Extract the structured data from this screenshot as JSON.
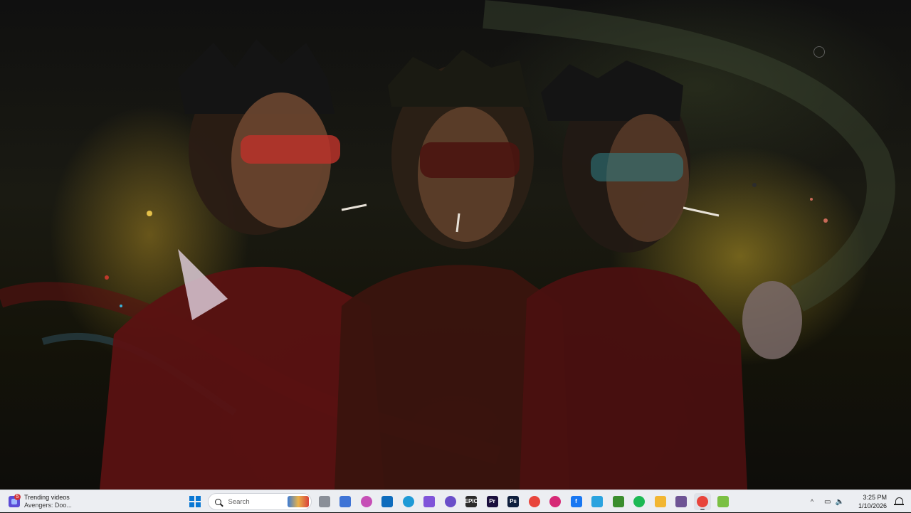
{
  "widget": {
    "badge": "5",
    "title": "Trending videos",
    "subtitle": "Avengers: Doo..."
  },
  "search": {
    "placeholder": "Search"
  },
  "taskbar_apps": [
    {
      "name": "file-explorer-doc",
      "label": "",
      "color": "#8a8f98"
    },
    {
      "name": "microsoft-store",
      "label": "",
      "color": "#3f74d6"
    },
    {
      "name": "copilot",
      "label": "",
      "color": "#c64fb6"
    },
    {
      "name": "outlook",
      "label": "",
      "color": "#0f6cbd"
    },
    {
      "name": "edge",
      "label": "",
      "color": "#1f9ad6"
    },
    {
      "name": "m365",
      "label": "",
      "color": "#8054d9"
    },
    {
      "name": "edge-dev",
      "label": "",
      "color": "#6a4fc9"
    },
    {
      "name": "epic-games",
      "label": "EPIC",
      "color": "#2b2b2b"
    },
    {
      "name": "premiere-pro",
      "label": "Pr",
      "color": "#1a0f3d"
    },
    {
      "name": "photoshop",
      "label": "Ps",
      "color": "#0f1f3d"
    },
    {
      "name": "chrome",
      "label": "",
      "color": "#e8453c"
    },
    {
      "name": "instagram",
      "label": "",
      "color": "#d62976"
    },
    {
      "name": "facebook",
      "label": "f",
      "color": "#1877f2"
    },
    {
      "name": "telegram",
      "label": "",
      "color": "#2aa3df"
    },
    {
      "name": "minecraft",
      "label": "",
      "color": "#3b8e2e"
    },
    {
      "name": "spotify",
      "label": "",
      "color": "#1db954"
    },
    {
      "name": "file-explorer",
      "label": "",
      "color": "#f2b632"
    },
    {
      "name": "github-desktop",
      "label": "",
      "color": "#6e5494"
    },
    {
      "name": "chrome-active",
      "label": "",
      "color": "#e8453c"
    },
    {
      "name": "cube-app",
      "label": "",
      "color": "#7bc043"
    }
  ],
  "tray": {
    "chevron": "^",
    "time": "3:25 PM",
    "date": "1/10/2026"
  },
  "colors": {
    "taskbar": "#eceef2",
    "accent": "#0a78d4"
  }
}
